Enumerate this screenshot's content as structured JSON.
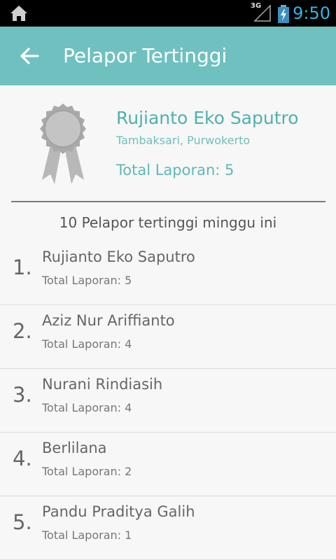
{
  "status_bar": {
    "network": "3G",
    "time": "9:50",
    "icons": [
      "home-icon",
      "signal-icon",
      "battery-charging-icon"
    ]
  },
  "action_bar": {
    "title": "Pelapor Tertinggi",
    "back_icon": "arrow-left-icon"
  },
  "top_reporter": {
    "name": "Rujianto Eko Saputro",
    "location": "Tambaksari, Purwokerto",
    "total": "Total Laporan: 5",
    "badge_icon": "award-ribbon-icon"
  },
  "list_heading": "10 Pelapor tertinggi minggu ini",
  "reporters": [
    {
      "rank": "1.",
      "name": "Rujianto Eko Saputro",
      "total": "Total Laporan: 5"
    },
    {
      "rank": "2.",
      "name": "Aziz Nur Ariffianto",
      "total": "Total Laporan: 4"
    },
    {
      "rank": "3.",
      "name": "Nurani Rindiasih",
      "total": "Total Laporan: 4"
    },
    {
      "rank": "4.",
      "name": "Berlilana",
      "total": "Total Laporan: 2"
    },
    {
      "rank": "5.",
      "name": "Pandu Praditya Galih",
      "total": "Total Laporan: 1"
    }
  ],
  "colors": {
    "action_bar": "#6fc1c0",
    "accent_text": "#4fb0ae",
    "clock": "#33b5e5",
    "background": "#f7f7f7"
  }
}
